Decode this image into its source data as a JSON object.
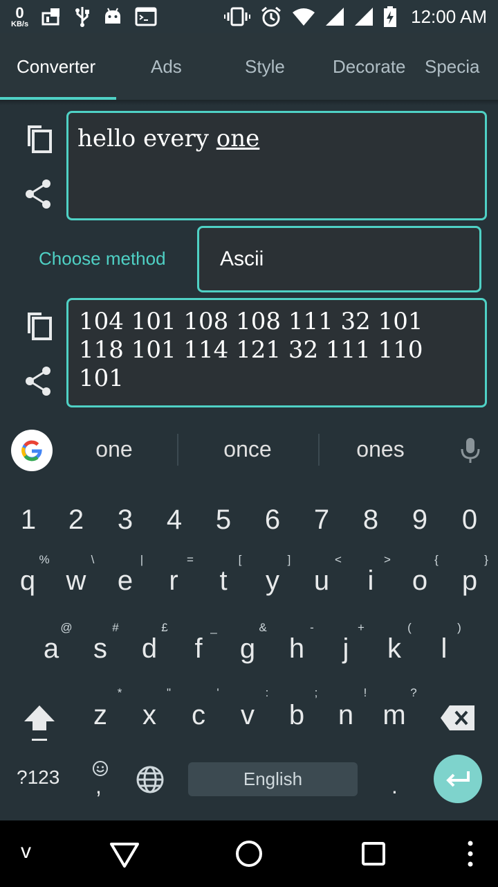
{
  "status_bar": {
    "net_speed_value": "0",
    "net_speed_unit": "KB/s",
    "time": "12:00 AM"
  },
  "tabs": [
    {
      "label": "Converter",
      "active": true
    },
    {
      "label": "Ads",
      "active": false
    },
    {
      "label": "Style",
      "active": false
    },
    {
      "label": "Decorate",
      "active": false
    },
    {
      "label": "Specia",
      "active": false
    }
  ],
  "converter": {
    "input_prefix": "hello every ",
    "input_underlined": "one",
    "choose_method_label": "Choose method",
    "method_value": "Ascii",
    "output_text": "104 101 108 108 111 32 101 118 101 114 121 32 111 110 101"
  },
  "keyboard": {
    "suggestions": [
      "one",
      "once",
      "ones"
    ],
    "number_row": [
      "1",
      "2",
      "3",
      "4",
      "5",
      "6",
      "7",
      "8",
      "9",
      "0"
    ],
    "row1": [
      "q",
      "w",
      "e",
      "r",
      "t",
      "y",
      "u",
      "i",
      "o",
      "p"
    ],
    "row1_hints": [
      "%",
      "\\",
      "|",
      "=",
      "[",
      "]",
      "<",
      ">",
      "{",
      "}"
    ],
    "row2": [
      "a",
      "s",
      "d",
      "f",
      "g",
      "h",
      "j",
      "k",
      "l"
    ],
    "row2_hints": [
      "@",
      "#",
      "£",
      "_",
      "&",
      "-",
      "+",
      "(",
      ")"
    ],
    "row3": [
      "z",
      "x",
      "c",
      "v",
      "b",
      "n",
      "m"
    ],
    "row3_hints": [
      "*",
      "\"",
      "'",
      ":",
      ";",
      "!",
      "?"
    ],
    "symbols_label": "?123",
    "comma_label": ",",
    "space_label": "English",
    "period_label": "."
  },
  "nav_bar": {
    "collapse_label": "v"
  },
  "colors": {
    "accent": "#4fd1c5",
    "background": "#263238",
    "enter_key": "#7ed3cc"
  }
}
